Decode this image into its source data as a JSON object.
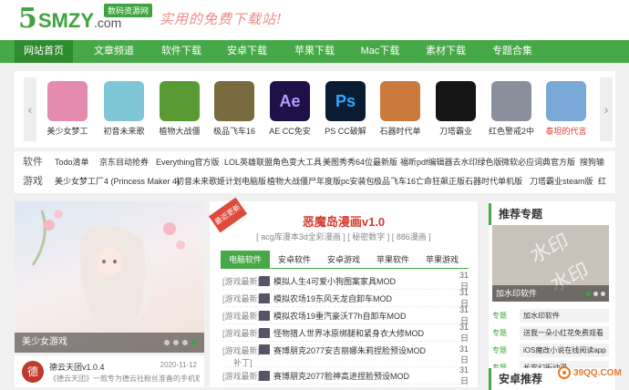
{
  "header": {
    "logo_mark": "5",
    "logo_text": "SMZY",
    "logo_suffix": ".com",
    "logo_badge": "数码资源网",
    "slogan": "实用的免费下载站!"
  },
  "nav": {
    "items": [
      "网站首页",
      "文章频道",
      "软件下载",
      "安卓下载",
      "苹果下载",
      "Mac下载",
      "素材下载",
      "专题合集"
    ],
    "active_index": 0
  },
  "carousel": {
    "prev_icon": "‹",
    "next_icon": "›",
    "items": [
      {
        "name": "美少女梦工",
        "color": "#e58bb0"
      },
      {
        "name": "初音未来歌",
        "color": "#7fc6d6"
      },
      {
        "name": "植物大战僵",
        "color": "#5a9a35"
      },
      {
        "name": "极品飞车16",
        "color": "#7a6a40"
      },
      {
        "name": "AE CC免安",
        "color": "#1f1147",
        "glyph": "Ae",
        "glyph_color": "#b69cff"
      },
      {
        "name": "PS CC破解",
        "color": "#0a1c33",
        "glyph": "Ps",
        "glyph_color": "#31a8ff"
      },
      {
        "name": "石器时代单",
        "color": "#c97a3c"
      },
      {
        "name": "刀塔霸业",
        "color": "#161616"
      },
      {
        "name": "红色警戒2中",
        "color": "#8a8f9c"
      },
      {
        "name": "泰坦的代言",
        "color": "#7aa9d8",
        "name_color": "#d63a2c"
      }
    ]
  },
  "tags": {
    "software_label": "软件",
    "software": [
      "Todo清单",
      "京东目动抢券",
      "Everything官方版",
      "LOL英雄联盟角色变大工具",
      "美图秀秀64位最新版",
      "福昕pdf编辑器去水印绿色版",
      "微软必应词典官方版",
      "搜狗输"
    ],
    "games_label": "游戏",
    "games": [
      "美少女梦工厂4 (Princess Maker 4)",
      "初音未来歌姬计划电脑版",
      "植物大战僵尸年度版pc安装包",
      "极品飞车16亡命狂飙正版",
      "石器时代单机版",
      "刀塔霸业steam版",
      "红"
    ]
  },
  "banner": {
    "caption": "美少女游戏",
    "dots": 4,
    "active_dot": 3
  },
  "news": {
    "title": "德云天团v1.0.4",
    "date": "2020-11-12",
    "desc": "《德云天团》一款专为德云社粉丝准备的手机软件。"
  },
  "center": {
    "ribbon": "最近更新",
    "hot_title": "恶魔岛漫画v1.0",
    "hot_meta": [
      "acg库漫本3d全彩漫画",
      "秘密数字",
      "886漫画"
    ],
    "tabs": [
      "电脑软件",
      "安卓软件",
      "安卓游戏",
      "苹果软件",
      "苹果游戏"
    ],
    "active_tab": 0,
    "rows": [
      {
        "cat": "[游戏最新]",
        "title": "模拟人生4可爱小狗图案家具MOD",
        "date": "31日"
      },
      {
        "cat": "[游戏最新]",
        "title": "模拟农场19东风天龙自卸车MOD",
        "date": "31日"
      },
      {
        "cat": "[游戏最新]",
        "title": "模拟农场19重汽豪沃T7h自卸车MOD",
        "date": "31日"
      },
      {
        "cat": "[游戏最新]",
        "title": "怪物猎人世界冰原绑腿和紧身衣大修MOD",
        "date": "31日"
      },
      {
        "cat": "[游戏最新]",
        "title": "赛博朋克2077安吉丽娜朱莉捏脸预设MOD",
        "date": "31日"
      },
      {
        "cat": "[游戏最新]",
        "title": "赛博朋克2077脸神高进捏脸预设MOD",
        "date": "31日"
      }
    ],
    "row_extra": "补丁]"
  },
  "right": {
    "recommend_title": "推荐专题",
    "image_caption": "加水印软件",
    "image_watermark_a": "水印",
    "image_watermark_b": "水印",
    "list_tag": "专题",
    "list": [
      "加水印软件",
      "送我一朵小红花免费观看",
      "iOS魔改小说在线阅读app",
      "长安幻街动漫"
    ],
    "android_title": "安卓推荐"
  },
  "footer_watermark": "39QQ.COM"
}
